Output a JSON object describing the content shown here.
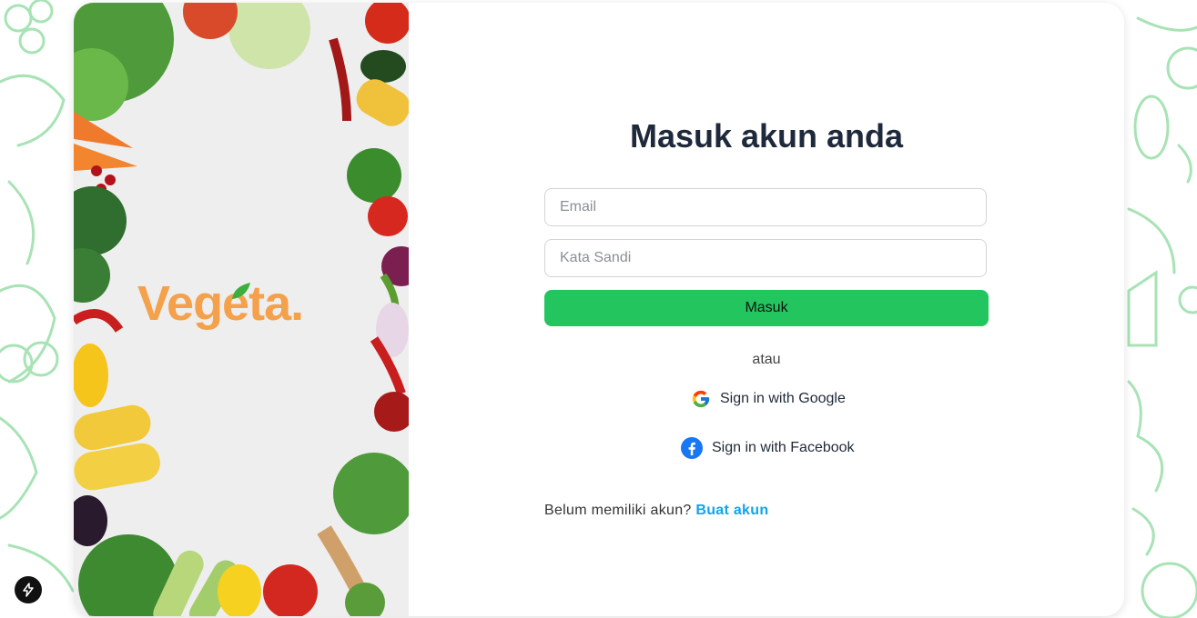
{
  "brand": {
    "logo_text": "Vegeta."
  },
  "login": {
    "title": "Masuk akun anda",
    "email_placeholder": "Email",
    "password_placeholder": "Kata Sandi",
    "submit_label": "Masuk",
    "or_label": "atau",
    "google_label": "Sign in with Google",
    "facebook_label": "Sign in with Facebook",
    "signup_prompt": "Belum memiliki akun?",
    "signup_link": "Buat akun"
  },
  "colors": {
    "accent_green": "#22c55e",
    "link_blue": "#0ea5e9",
    "title_dark": "#1e293b",
    "logo_orange": "#f5a04a",
    "pattern_green": "#a7e3b5"
  },
  "icons": [
    "google-icon",
    "facebook-icon",
    "nextjs-badge-icon",
    "leaf-icon"
  ]
}
